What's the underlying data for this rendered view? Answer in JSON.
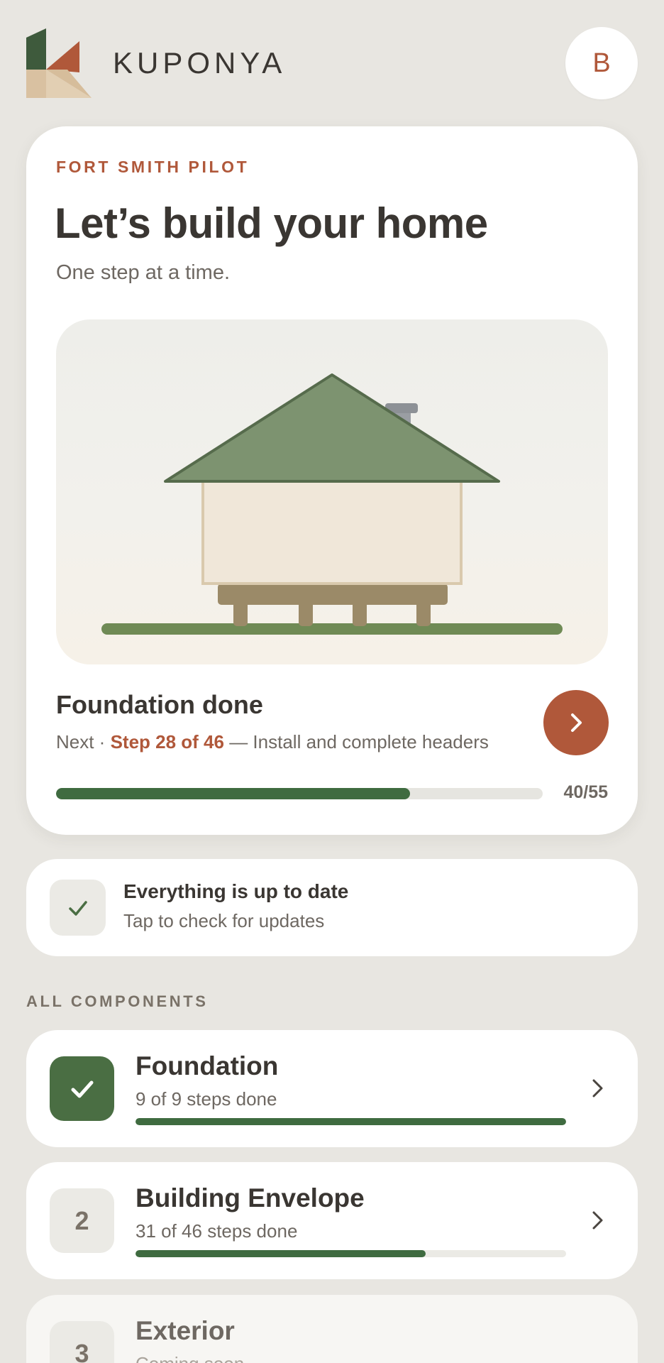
{
  "app": {
    "brand_name": "KUPONYA",
    "avatar_initial": "B"
  },
  "hero": {
    "eyebrow": "FORT SMITH PILOT",
    "title": "Let’s build your home",
    "subtitle": "One step at a time.",
    "milestone": "Foundation done",
    "next_prefix": "Next · ",
    "next_step": "Step 28 of 46",
    "next_suffix": " — Install and complete headers",
    "progress": {
      "done": 40,
      "total": 55,
      "label": "40/55"
    }
  },
  "update_card": {
    "title": "Everything is up to date",
    "subtitle": "Tap to check for updates"
  },
  "section_label": "ALL COMPONENTS",
  "components": [
    {
      "name": "Foundation",
      "badge": "",
      "status": "done",
      "steps_label": "9 of 9 steps done",
      "done": 9,
      "total": 9
    },
    {
      "name": "Building Envelope",
      "badge": "2",
      "status": "in-progress",
      "steps_label": "31 of 46 steps done",
      "done": 31,
      "total": 46
    },
    {
      "name": "Exterior",
      "badge": "3",
      "status": "coming-soon",
      "steps_label": "Coming soon"
    }
  ],
  "colors": {
    "background": "#e8e6e1",
    "accent": "#b0583a",
    "progress_green": "#3f6b40",
    "roof_green": "#7d9370",
    "track": "#e6e5e0"
  },
  "icons": {
    "avatar": "avatar-initial",
    "next": "chevron-right-icon",
    "update": "check-icon",
    "component_done": "check-icon",
    "component_row": "chevron-right-icon"
  }
}
